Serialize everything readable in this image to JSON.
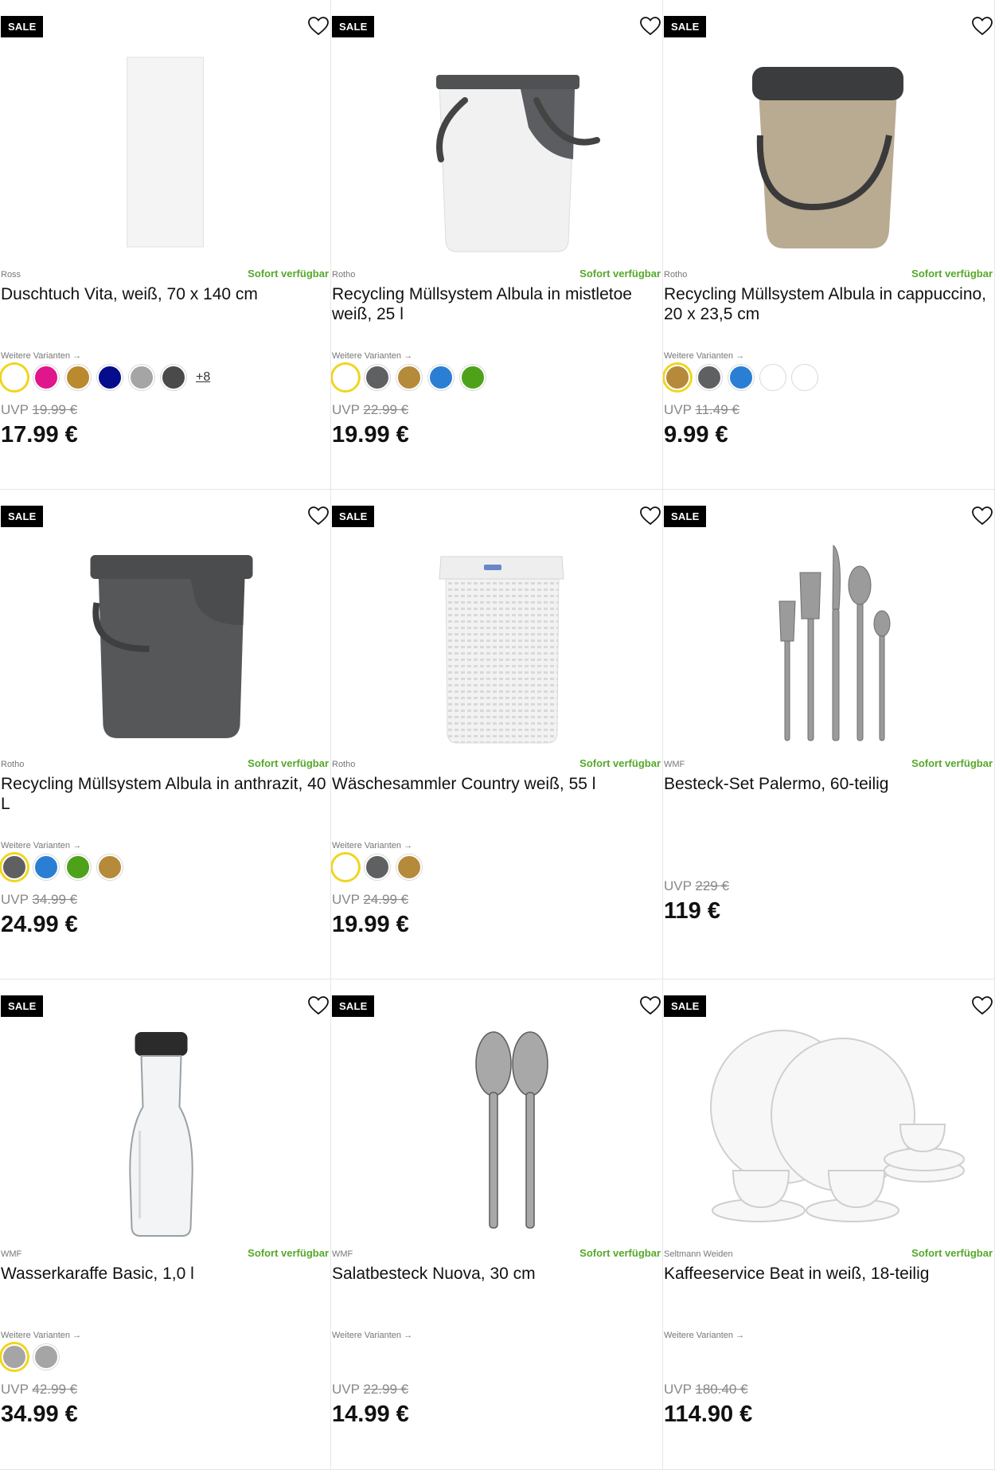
{
  "badge_label": "SALE",
  "availability_label": "Sofort verfügbar",
  "variants_label": "Weitere Varianten →",
  "uvp_label": "UVP",
  "products": [
    {
      "brand": "Ross",
      "title": "Duschtuch Vita, weiß, 70 x 140 cm",
      "uvp_price": "19.99 €",
      "price": "17.99 €",
      "swatches": [
        "#ffffff",
        "#e0168c",
        "#bb8a2e",
        "#050d8c",
        "#a5a5a5",
        "#4a4a4a"
      ],
      "more_label": "+8",
      "image_icon": "towel-icon"
    },
    {
      "brand": "Rotho",
      "title": "Recycling Müllsystem Albula in mistletoe weiß, 25 l",
      "uvp_price": "22.99 €",
      "price": "19.99 €",
      "swatches": [
        "#ffffff",
        "#5f6062",
        "#b58a3a",
        "#2a7fd4",
        "#4ea21a"
      ],
      "image_icon": "bin-white-icon"
    },
    {
      "brand": "Rotho",
      "title": "Recycling Müllsystem Albula in cappuccino, 20 x 23,5 cm",
      "uvp_price": "11.49 €",
      "price": "9.99 €",
      "swatches": [
        "#b58a3a",
        "#5f6062",
        "#2a7fd4",
        "#ffffff",
        "#ffffff"
      ],
      "image_icon": "bin-cappuccino-icon"
    },
    {
      "brand": "Rotho",
      "title": "Recycling Müllsystem Albula in anthrazit, 40 L",
      "uvp_price": "34.99 €",
      "price": "24.99 €",
      "swatches": [
        "#5f6062",
        "#2a7fd4",
        "#4ea21a",
        "#b58a3a"
      ],
      "image_icon": "bin-anthracite-icon"
    },
    {
      "brand": "Rotho",
      "title": "Wäschesammler Country weiß, 55 l",
      "uvp_price": "24.99 €",
      "price": "19.99 €",
      "swatches": [
        "#ffffff",
        "#5f6062",
        "#b58a3a"
      ],
      "image_icon": "laundry-basket-icon"
    },
    {
      "brand": "WMF",
      "title": "Besteck-Set Palermo, 60-teilig",
      "uvp_price": "229 €",
      "price": "119 €",
      "swatches": [],
      "image_icon": "cutlery-icon"
    },
    {
      "brand": "WMF",
      "title": "Wasserkaraffe Basic, 1,0 l",
      "uvp_price": "42.99 €",
      "price": "34.99 €",
      "swatches": [
        "#a5a5a5",
        "#a5a5a5"
      ],
      "image_icon": "carafe-icon"
    },
    {
      "brand": "WMF",
      "title": "Salatbesteck Nuova, 30 cm",
      "uvp_price": "22.99 €",
      "price": "14.99 €",
      "swatches": [],
      "image_icon": "salad-servers-icon"
    },
    {
      "brand": "Seltmann Weiden",
      "title": "Kaffeeservice Beat in weiß, 18-teilig",
      "uvp_price": "180.40 €",
      "price": "114.90 €",
      "swatches": [],
      "image_icon": "coffee-set-icon"
    }
  ]
}
